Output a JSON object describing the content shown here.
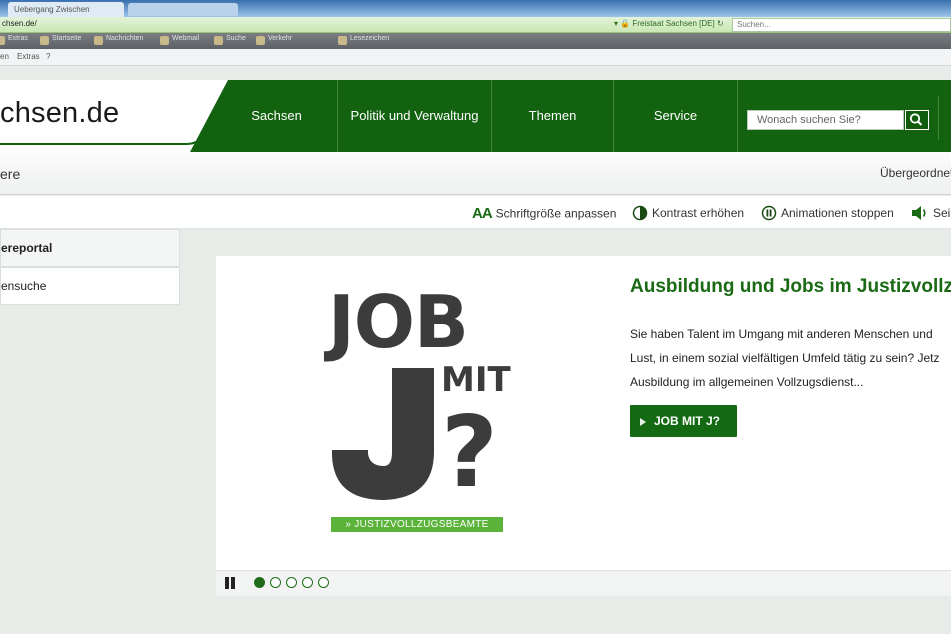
{
  "browser": {
    "tab_active": "Uebergang Zwischen",
    "tab_inactive": "",
    "url": "chsen.de/",
    "ssl_label": "Freistaat Sachsen [DE]",
    "search_placeholder": "Suchen...",
    "favorites": [
      "Extras",
      "Startseite",
      "Nachrichten",
      "Webmail",
      "Suche",
      "Verkehr",
      "Lesezeichen"
    ],
    "menu": [
      "en",
      "Extras",
      "?"
    ]
  },
  "site": {
    "logo": "chsen.de",
    "nav": [
      {
        "label": "Sachsen"
      },
      {
        "label": "Politik und Verwaltung"
      },
      {
        "label": "Themen"
      },
      {
        "label": "Service"
      }
    ],
    "search_placeholder": "Wonach suchen Sie?"
  },
  "breadcrumb": {
    "left": "ere",
    "right": "Übergeordnet"
  },
  "a11y": {
    "fontsize_icon_text": "AA",
    "fontsize": "Schriftgröße anpassen",
    "contrast": "Kontrast erhöhen",
    "animations": "Animationen stoppen",
    "read": "Sei"
  },
  "sidebar": {
    "items": [
      {
        "label": "ereportal",
        "active": true
      },
      {
        "label": "ensuche",
        "active": false
      }
    ]
  },
  "slide": {
    "graphic": {
      "word1": "JOB",
      "word2": "MIT",
      "word3": "?",
      "tagline": "» JUSTIZVOLLZUGSBEAMTE"
    },
    "headline": "Ausbildung und Jobs im Justizvollz",
    "teaser": [
      "Sie haben Talent im Umgang mit anderen Menschen und",
      "Lust, in einem sozial vielfältigen Umfeld tätig zu sein? Jetz",
      "Ausbildung im allgemeinen Vollzugsdienst..."
    ],
    "cta": "JOB MIT J?",
    "dots": 5,
    "active_dot": 0
  },
  "colors": {
    "brand_green": "#12620f",
    "headline_green": "#1a6a14",
    "tagline_green": "#5bb33a"
  }
}
